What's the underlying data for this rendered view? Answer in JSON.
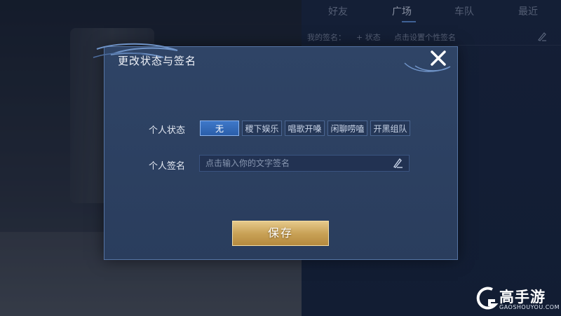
{
  "background": {
    "tabs": [
      "好友",
      "广场",
      "车队",
      "最近"
    ],
    "active_tab": "广场",
    "signature_label": "我的签名：",
    "status_link": "+ 状态",
    "signature_hint": "点击设置个性签名"
  },
  "dialog": {
    "title": "更改状态与签名",
    "close_icon": "close-icon",
    "status_label": "个人状态",
    "status_options": [
      "无",
      "稷下娱乐",
      "唱歌开嗓",
      "闲聊唠嗑",
      "开黑组队"
    ],
    "selected_status": "无",
    "signature_label": "个人签名",
    "signature_placeholder": "点击输入你的文字签名",
    "pen_icon": "pen-icon",
    "save_label": "保存"
  },
  "watermark": {
    "brand": "高手游",
    "url": "GAOSHOUYOU.COM"
  },
  "colors": {
    "dialog_bg": "#2f4466",
    "active_status": "#3e78c9",
    "save_button": "#c9a257"
  }
}
